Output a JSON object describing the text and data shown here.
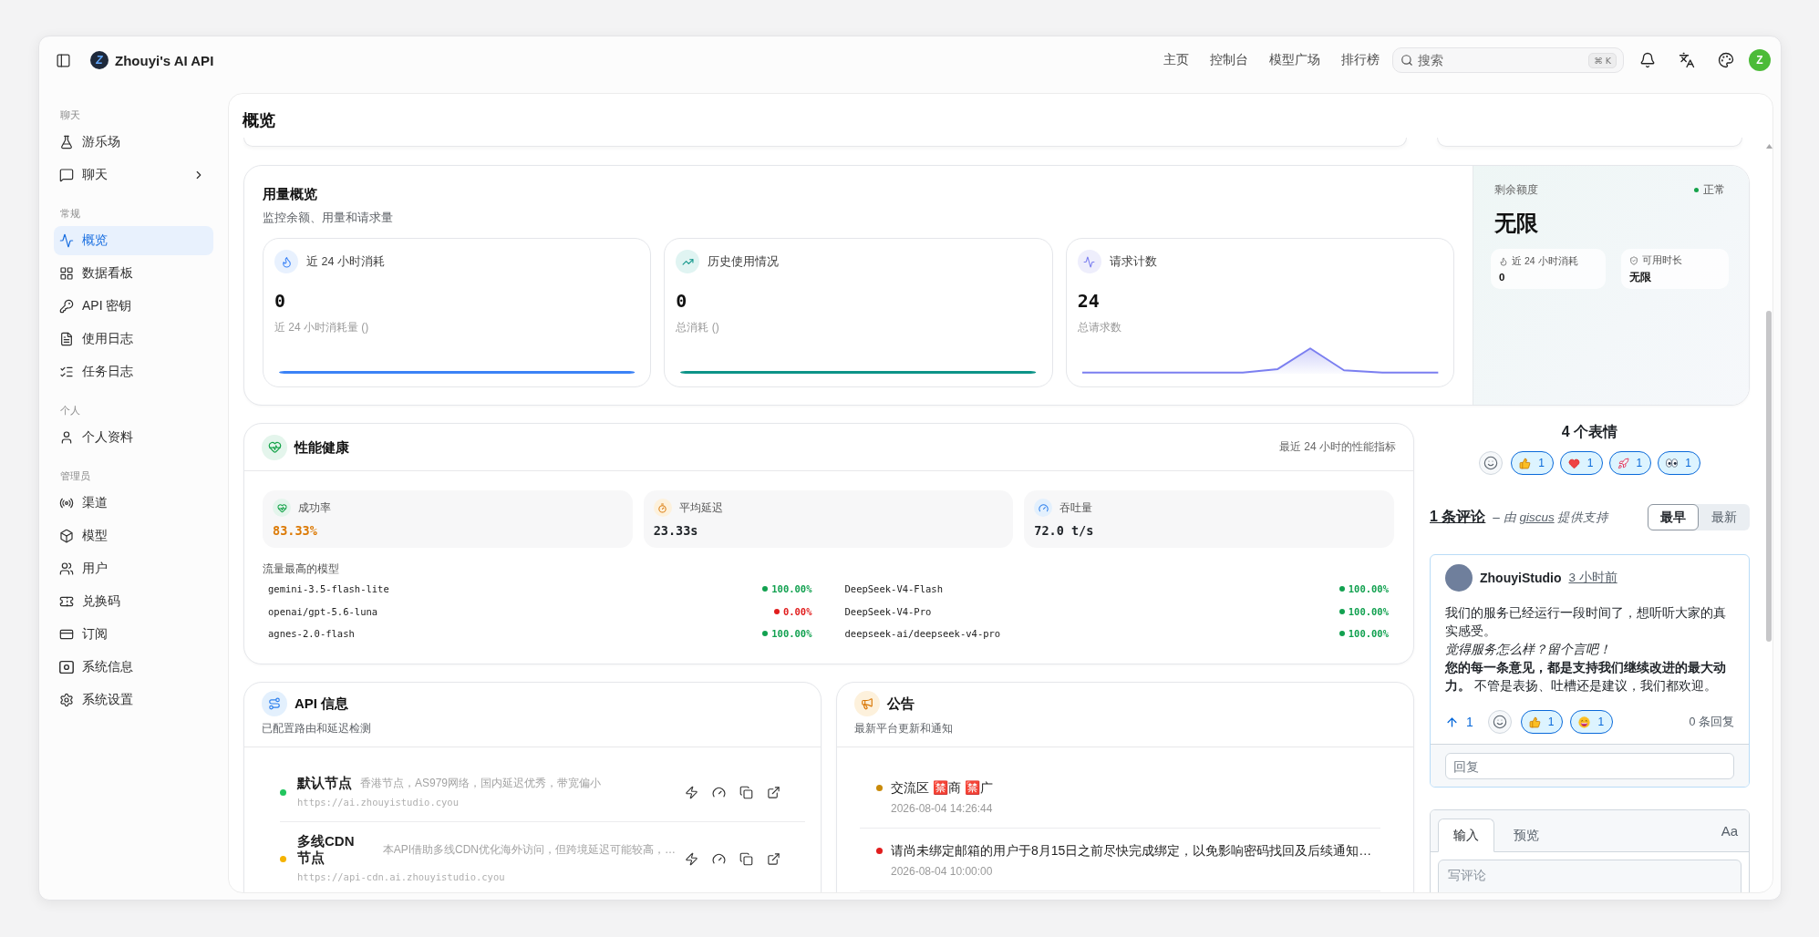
{
  "app": {
    "logo_letter": "Z",
    "title": "Zhouyi's AI API"
  },
  "nav": [
    "主页",
    "控制台",
    "模型广场",
    "排行榜"
  ],
  "search": {
    "placeholder": "搜索",
    "shortcut": "⌘ K"
  },
  "user": {
    "avatar_letter": "Z"
  },
  "sidebar": {
    "sections": [
      {
        "label": "聊天",
        "items": [
          {
            "label": "游乐场",
            "selected": false,
            "has_submenu": false
          },
          {
            "label": "聊天",
            "selected": false,
            "has_submenu": true
          }
        ]
      },
      {
        "label": "常规",
        "items": [
          {
            "label": "概览",
            "selected": true,
            "has_submenu": false
          },
          {
            "label": "数据看板",
            "selected": false,
            "has_submenu": false
          },
          {
            "label": "API 密钥",
            "selected": false,
            "has_submenu": false
          },
          {
            "label": "使用日志",
            "selected": false,
            "has_submenu": false
          },
          {
            "label": "任务日志",
            "selected": false,
            "has_submenu": false
          }
        ]
      },
      {
        "label": "个人",
        "items": [
          {
            "label": "个人资料",
            "selected": false,
            "has_submenu": false
          }
        ]
      },
      {
        "label": "管理员",
        "items": [
          {
            "label": "渠道",
            "selected": false,
            "has_submenu": false
          },
          {
            "label": "模型",
            "selected": false,
            "has_submenu": false
          },
          {
            "label": "用户",
            "selected": false,
            "has_submenu": false
          },
          {
            "label": "兑换码",
            "selected": false,
            "has_submenu": false
          },
          {
            "label": "订阅",
            "selected": false,
            "has_submenu": false
          },
          {
            "label": "系统信息",
            "selected": false,
            "has_submenu": false
          },
          {
            "label": "系统设置",
            "selected": false,
            "has_submenu": false
          }
        ]
      }
    ]
  },
  "page": {
    "title": "概览"
  },
  "usage": {
    "title": "用量概览",
    "subtitle": "监控余额、用量和请求量",
    "stats": [
      {
        "label": "近 24 小时消耗",
        "value": "0",
        "caption": "近 24 小时消耗量 ()"
      },
      {
        "label": "历史使用情况",
        "value": "0",
        "caption": "总消耗 ()"
      },
      {
        "label": "请求计数",
        "value": "24",
        "caption": "总请求数"
      }
    ]
  },
  "balance": {
    "label": "剩余额度",
    "status": "正常",
    "value": "无限",
    "details": [
      {
        "label": "近 24 小时消耗",
        "value": "0"
      },
      {
        "label": "可用时长",
        "value": "无限"
      }
    ]
  },
  "performance": {
    "title": "性能健康",
    "note": "最近 24 小时的性能指标",
    "metrics": [
      {
        "label": "成功率",
        "value": "83.33%",
        "warning": true
      },
      {
        "label": "平均延迟",
        "value": "23.33s",
        "warning": false
      },
      {
        "label": "吞吐量",
        "value": "72.0 t/s",
        "warning": false
      }
    ],
    "top_models_title": "流量最高的模型",
    "models": [
      {
        "name": "gemini-3.5-flash-lite",
        "rate": "100.00%",
        "healthy": true
      },
      {
        "name": "openai/gpt-5.6-luna",
        "rate": "0.00%",
        "healthy": false
      },
      {
        "name": "agnes-2.0-flash",
        "rate": "100.00%",
        "healthy": true
      },
      {
        "name": "DeepSeek-V4-Flash",
        "rate": "100.00%",
        "healthy": true
      },
      {
        "name": "DeepSeek-V4-Pro",
        "rate": "100.00%",
        "healthy": true
      },
      {
        "name": "deepseek-ai/deepseek-v4-pro",
        "rate": "100.00%",
        "healthy": true
      }
    ]
  },
  "api_info": {
    "title": "API 信息",
    "subtitle": "已配置路由和延迟检测",
    "routes": [
      {
        "name": "默认节点",
        "description": "香港节点，AS979网络，国内延迟优秀，带宽偏小",
        "url": "https://ai.zhouyistudio.cyou",
        "color": "#22c55e"
      },
      {
        "name": "多线CDN 节点",
        "description": "本API借助多线CDN优化海外访问，但跨境延迟可能较高，…",
        "url": "https://api-cdn.ai.zhouyistudio.cyou",
        "color": "#f5b301"
      }
    ]
  },
  "announcements": {
    "title": "公告",
    "subtitle": "最新平台更新和通知",
    "items": [
      {
        "text": "交流区 🈲商 🈲广",
        "time": "2026-08-04 14:26:44",
        "color": "#c98a0a"
      },
      {
        "text": "请尚未绑定邮箱的用户于8月15日之前尽快完成绑定，以免影响密码找回及后续通知…",
        "time": "2026-08-04 10:00:00",
        "color": "#e11d1d"
      }
    ]
  },
  "discussion": {
    "reactions_title": "4 个表情",
    "reactions": [
      {
        "count": "1",
        "selected": true
      },
      {
        "count": "1",
        "selected": true
      },
      {
        "count": "1",
        "selected": true
      },
      {
        "count": "1",
        "selected": true
      }
    ],
    "comment_count": "1 条评论",
    "powered_by": {
      "before": "– 由",
      "link": "giscus",
      "after": "提供支持"
    },
    "sort": [
      {
        "label": "最早",
        "selected": true
      },
      {
        "label": "最新",
        "selected": false
      }
    ],
    "comment": {
      "author": "ZhouyiStudio",
      "time": "3 小时前",
      "body": [
        {
          "text": "我们的服务已经运行一段时间了，想听听大家的真实感受。",
          "kind": "plain"
        },
        {
          "text": "觉得服务怎么样？留个言吧！",
          "kind": "italic"
        },
        {
          "text": "**您的每一条意见，都是支持我们继续改进的最大动力。** 不管是表扬、吐槽还是建议，我们都欢迎。",
          "kind": "plain"
        }
      ],
      "upvotes": "1",
      "reactions": [
        {
          "count": "1",
          "selected": true
        },
        {
          "count": "1",
          "selected": true
        }
      ],
      "replies": "0 条回复",
      "reply_placeholder": "回复"
    },
    "editor": {
      "tabs": [
        {
          "label": "输入",
          "selected": true
        },
        {
          "label": "预览",
          "selected": false
        }
      ],
      "format_label": "Aa",
      "placeholder": "写评论"
    }
  }
}
